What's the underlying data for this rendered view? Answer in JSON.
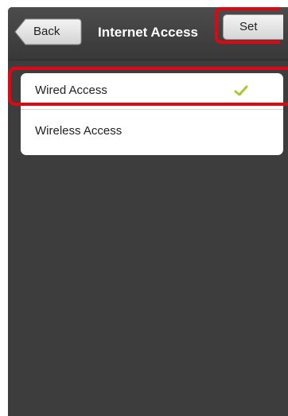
{
  "navbar": {
    "back_label": "Back",
    "title": "Internet Access",
    "set_label": "Set"
  },
  "options": [
    {
      "label": "Wired Access",
      "selected": true
    },
    {
      "label": "Wireless Access",
      "selected": false
    }
  ],
  "colors": {
    "background": "#3d3d3d",
    "highlight": "#e20613",
    "checkmark": "#a6c834"
  },
  "icons": {
    "selected_indicator": "checkmark-icon"
  }
}
